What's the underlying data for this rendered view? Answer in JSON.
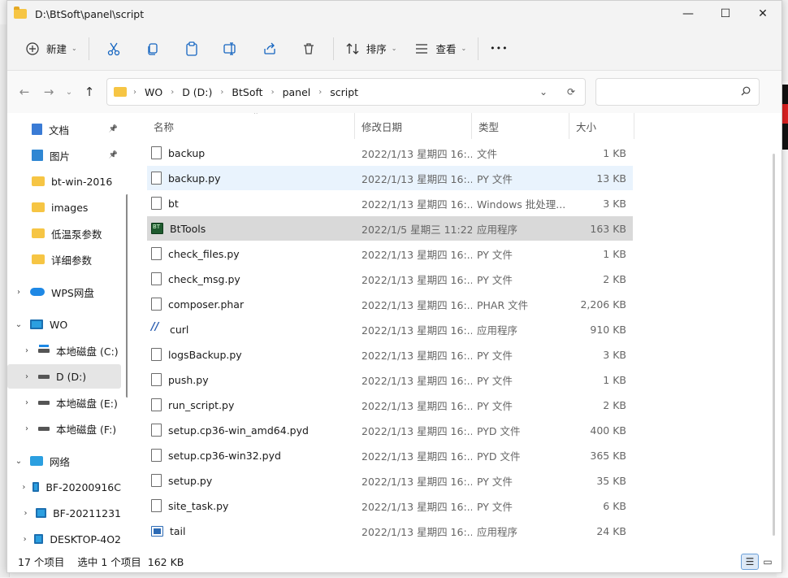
{
  "window": {
    "title": "D:\\BtSoft\\panel\\script",
    "controls": {
      "minimize": "—",
      "maximize": "☐",
      "close": "✕"
    }
  },
  "toolbar": {
    "new_label": "新建",
    "sort_label": "排序",
    "view_label": "查看",
    "more_label": "•••"
  },
  "address": {
    "crumbs": [
      "WO",
      "D (D:)",
      "BtSoft",
      "panel",
      "script"
    ],
    "search_placeholder": ""
  },
  "sidebar": {
    "items": [
      {
        "label": "文档",
        "icon": "document-icon",
        "pinned": true
      },
      {
        "label": "图片",
        "icon": "picture-icon",
        "pinned": true
      },
      {
        "label": "bt-win-2016",
        "icon": "folder-icon"
      },
      {
        "label": "images",
        "icon": "folder-icon"
      },
      {
        "label": "低温泵参数",
        "icon": "folder-icon"
      },
      {
        "label": "详细参数",
        "icon": "folder-icon"
      },
      {
        "label": "WPS网盘",
        "icon": "cloud-icon"
      },
      {
        "label": "WO",
        "icon": "computer-icon"
      },
      {
        "label": "本地磁盘 (C:)",
        "icon": "drive-icon"
      },
      {
        "label": "D (D:)",
        "icon": "drive-icon"
      },
      {
        "label": "本地磁盘 (E:)",
        "icon": "drive-icon"
      },
      {
        "label": "本地磁盘 (F:)",
        "icon": "drive-icon"
      },
      {
        "label": "网络",
        "icon": "network-icon"
      },
      {
        "label": "BF-20200916C",
        "icon": "computer-icon"
      },
      {
        "label": "BF-20211231",
        "icon": "computer-icon"
      },
      {
        "label": "DESKTOP-4O2",
        "icon": "computer-icon"
      }
    ]
  },
  "columns": {
    "name": "名称",
    "date": "修改日期",
    "type": "类型",
    "size": "大小"
  },
  "files": [
    {
      "name": "backup",
      "date": "2022/1/13 星期四 16:...",
      "type": "文件",
      "size": "1 KB"
    },
    {
      "name": "backup.py",
      "date": "2022/1/13 星期四 16:...",
      "type": "PY 文件",
      "size": "13 KB"
    },
    {
      "name": "bt",
      "date": "2022/1/13 星期四 16:...",
      "type": "Windows 批处理...",
      "size": "3 KB"
    },
    {
      "name": "BtTools",
      "date": "2022/1/5 星期三 11:22",
      "type": "应用程序",
      "size": "163 KB"
    },
    {
      "name": "check_files.py",
      "date": "2022/1/13 星期四 16:...",
      "type": "PY 文件",
      "size": "1 KB"
    },
    {
      "name": "check_msg.py",
      "date": "2022/1/13 星期四 16:...",
      "type": "PY 文件",
      "size": "2 KB"
    },
    {
      "name": "composer.phar",
      "date": "2022/1/13 星期四 16:...",
      "type": "PHAR 文件",
      "size": "2,206 KB"
    },
    {
      "name": "curl",
      "date": "2022/1/13 星期四 16:...",
      "type": "应用程序",
      "size": "910 KB"
    },
    {
      "name": "logsBackup.py",
      "date": "2022/1/13 星期四 16:...",
      "type": "PY 文件",
      "size": "3 KB"
    },
    {
      "name": "push.py",
      "date": "2022/1/13 星期四 16:...",
      "type": "PY 文件",
      "size": "1 KB"
    },
    {
      "name": "run_script.py",
      "date": "2022/1/13 星期四 16:...",
      "type": "PY 文件",
      "size": "2 KB"
    },
    {
      "name": "setup.cp36-win_amd64.pyd",
      "date": "2022/1/13 星期四 16:...",
      "type": "PYD 文件",
      "size": "400 KB"
    },
    {
      "name": "setup.cp36-win32.pyd",
      "date": "2022/1/13 星期四 16:...",
      "type": "PYD 文件",
      "size": "365 KB"
    },
    {
      "name": "setup.py",
      "date": "2022/1/13 星期四 16:...",
      "type": "PY 文件",
      "size": "35 KB"
    },
    {
      "name": "site_task.py",
      "date": "2022/1/13 星期四 16:...",
      "type": "PY 文件",
      "size": "6 KB"
    },
    {
      "name": "tail",
      "date": "2022/1/13 星期四 16:...",
      "type": "应用程序",
      "size": "24 KB"
    }
  ],
  "status": {
    "count": "17 个项目",
    "selection": "选中 1 个项目  162 KB"
  }
}
